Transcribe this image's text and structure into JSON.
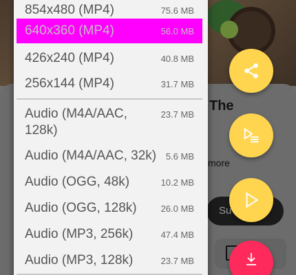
{
  "background": {
    "title_fragment": "The",
    "more_link": "more",
    "subscribe_fragment": "Su"
  },
  "menu": {
    "items": [
      {
        "label": "854x480 (MP4)",
        "size": "75.6 MB",
        "selected": false
      },
      {
        "label": "640x360 (MP4)",
        "size": "56.0 MB",
        "selected": true
      },
      {
        "label": "426x240 (MP4)",
        "size": "40.8 MB",
        "selected": false
      },
      {
        "label": "256x144 (MP4)",
        "size": "31.7 MB",
        "selected": false
      },
      {
        "label": "Audio (M4A/AAC,\n128k)",
        "size": "23.7 MB",
        "selected": false
      },
      {
        "label": "Audio (M4A/AAC, 32k)",
        "size": "5.6 MB",
        "selected": false
      },
      {
        "label": "Audio (OGG, 48k)",
        "size": "10.2 MB",
        "selected": false
      },
      {
        "label": "Audio (OGG, 128k)",
        "size": "26.0 MB",
        "selected": false
      },
      {
        "label": "Audio (MP3, 256k)",
        "size": "47.4 MB",
        "selected": false
      },
      {
        "label": "Audio (MP3, 128k)",
        "size": "23.7 MB",
        "selected": false
      }
    ]
  },
  "fabs": [
    {
      "name": "share-button",
      "icon": "share-icon",
      "color": "#ffd54f"
    },
    {
      "name": "add-to-playlist-button",
      "icon": "playlist-add-icon",
      "color": "#ffd54f"
    },
    {
      "name": "play-button",
      "icon": "play-icon",
      "color": "#ffd54f"
    },
    {
      "name": "download-button",
      "icon": "download-icon",
      "color": "#ff2a5c"
    }
  ],
  "colors": {
    "selected_highlight": "#ff00ff",
    "fab_yellow": "#ffd54f",
    "fab_red": "#ff2a5c"
  }
}
